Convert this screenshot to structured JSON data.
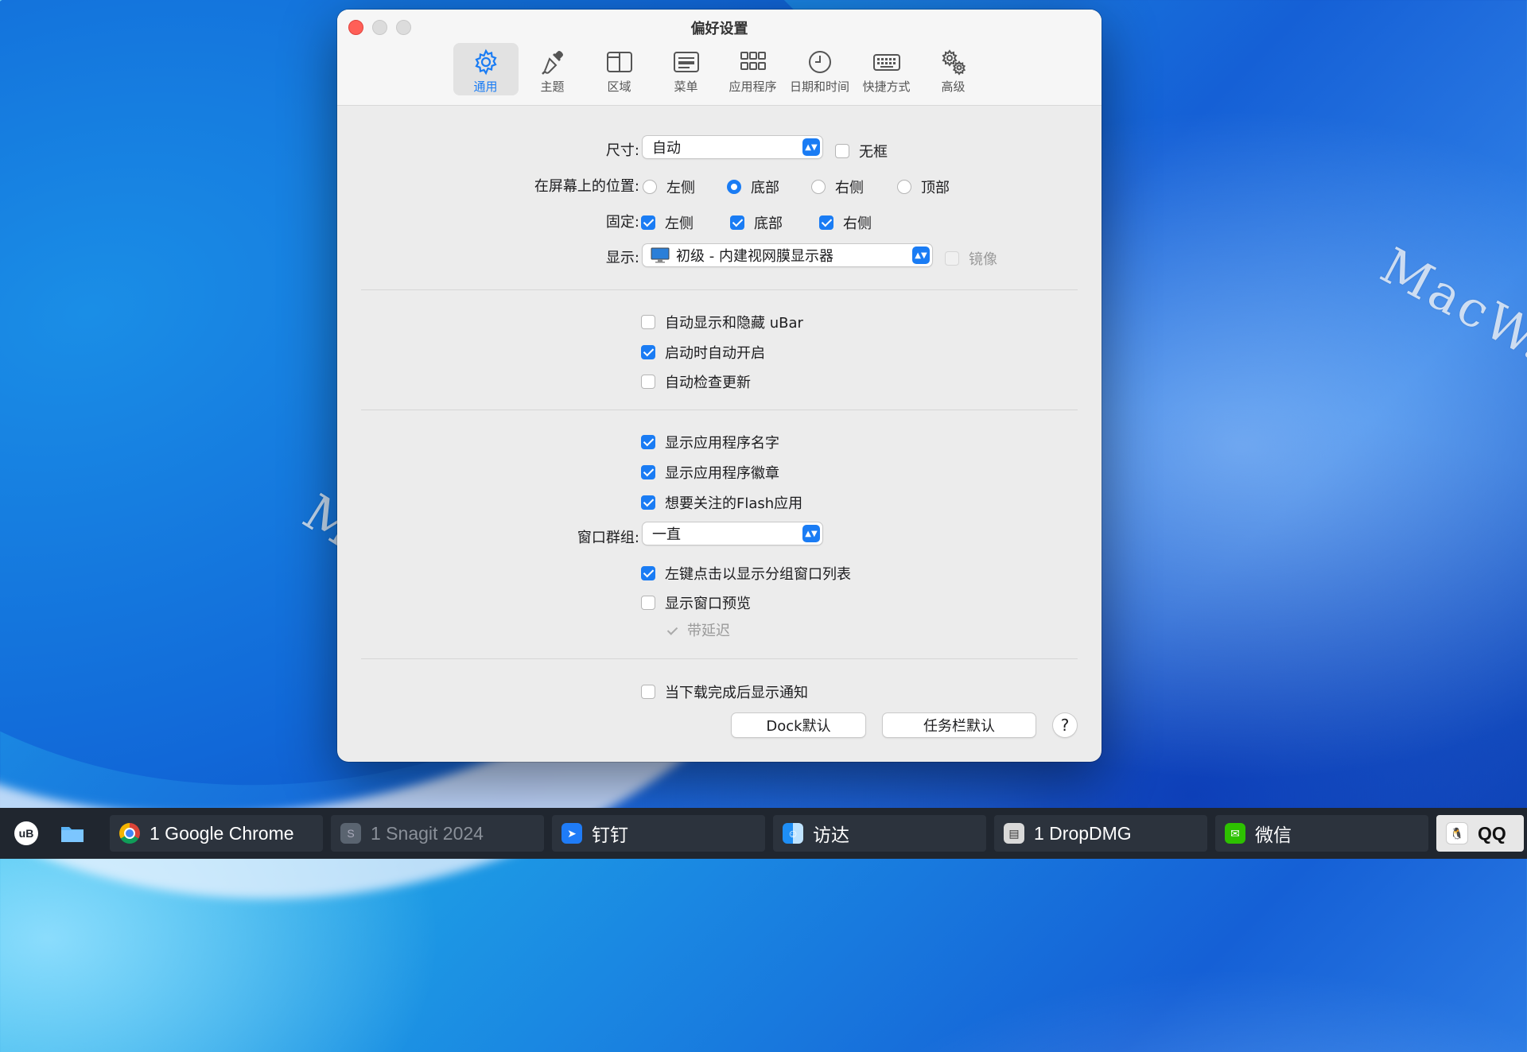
{
  "window": {
    "title": "偏好设置"
  },
  "toolbar": {
    "items": [
      {
        "label": "通用",
        "icon": "gear-icon",
        "active": true
      },
      {
        "label": "主题",
        "icon": "eyedropper-icon"
      },
      {
        "label": "区域",
        "icon": "split-panel-icon"
      },
      {
        "label": "菜单",
        "icon": "menu-card-icon"
      },
      {
        "label": "应用程序",
        "icon": "grid-icon"
      },
      {
        "label": "日期和时间",
        "icon": "clock-icon"
      },
      {
        "label": "快捷方式",
        "icon": "keyboard-icon"
      },
      {
        "label": "高级",
        "icon": "gears-icon"
      }
    ]
  },
  "general": {
    "size_label": "尺寸:",
    "size_value": "自动",
    "borderless_label": "无框",
    "position_label": "在屏幕上的位置:",
    "position_options": [
      "左侧",
      "底部",
      "右侧",
      "顶部"
    ],
    "position_selected": "底部",
    "pin_label": "固定:",
    "pin_options": [
      "左侧",
      "底部",
      "右侧"
    ],
    "display_label": "显示:",
    "display_value": "初级 - 内建视网膜显示器",
    "mirror_label": "镜像"
  },
  "startup": {
    "auto_hide": "自动显示和隐藏 uBar",
    "launch_at_login": "启动时自动开启",
    "check_updates": "自动检查更新"
  },
  "apps": {
    "show_names": "显示应用程序名字",
    "show_badges": "显示应用程序徽章",
    "flash_attention": "想要关注的Flash应用",
    "group_label": "窗口群组:",
    "group_value": "一直",
    "left_click_list": "左键点击以显示分组窗口列表",
    "window_preview": "显示窗口预览",
    "with_delay": "带延迟"
  },
  "notify": {
    "download_done": "当下载完成后显示通知"
  },
  "buttons": {
    "dock_default": "Dock默认",
    "taskbar_default": "任务栏默认",
    "help": "?"
  },
  "taskbar": {
    "launcher": "uB",
    "tasks": [
      {
        "label": "1 Google Chrome",
        "icon": "chrome-icon"
      },
      {
        "label": "1 Snagit 2024",
        "icon": "snagit-icon"
      },
      {
        "label": "钉钉",
        "icon": "dingtalk-icon"
      },
      {
        "label": "访达",
        "icon": "finder-icon"
      },
      {
        "label": "1 DropDMG",
        "icon": "dropdmg-icon"
      },
      {
        "label": "微信",
        "icon": "wechat-icon"
      },
      {
        "label": "QQ",
        "icon": "qq-icon"
      }
    ]
  },
  "watermark": "MacW.com",
  "colors": {
    "accent": "#1a7cf4",
    "close": "#ff5f57",
    "taskbar": "#20262f"
  }
}
